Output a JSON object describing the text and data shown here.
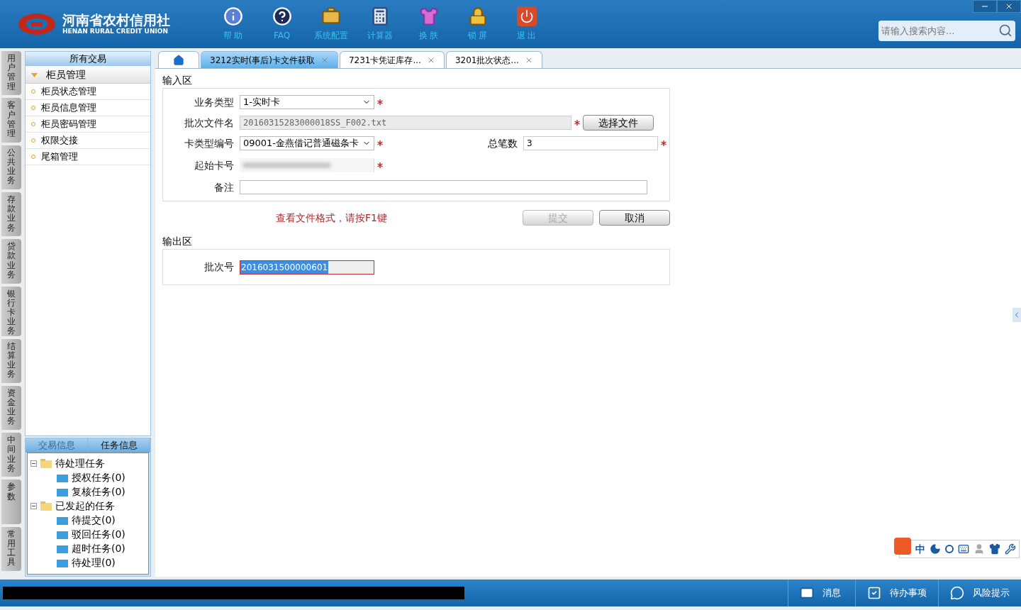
{
  "header": {
    "logo_title": "河南省农村信用社",
    "logo_subtitle": "HENAN RURAL CREDIT UNION",
    "toolbar": [
      {
        "kind": "info",
        "label": "帮 助"
      },
      {
        "kind": "faq",
        "label": "FAQ"
      },
      {
        "kind": "toolbox",
        "label": "系统配置"
      },
      {
        "kind": "calculator",
        "label": "计算器"
      },
      {
        "kind": "shirt",
        "label": "换 肤"
      },
      {
        "kind": "lock",
        "label": "锁 屏"
      },
      {
        "kind": "power",
        "label": "退 出"
      }
    ],
    "search": {
      "placeholder": "请输入搜索内容..."
    }
  },
  "side_tabs": [
    "用户管理",
    "客户管理",
    "公共业务",
    "存款业务",
    "贷款业务",
    "银行卡业务",
    "结算业务",
    "资金业务",
    "中间业务",
    "参数",
    "常用工具"
  ],
  "sidebar": {
    "title": "所有交易",
    "group": {
      "label": "柜员管理",
      "expanded": true,
      "items": [
        "柜员状态管理",
        "柜员信息管理",
        "柜员密码管理",
        "权限交接",
        "尾箱管理"
      ]
    }
  },
  "task_panel": {
    "tabs": [
      {
        "label": "交易信息",
        "selected": false
      },
      {
        "label": "任务信息",
        "selected": true
      }
    ],
    "tree": [
      {
        "label": "待处理任务",
        "expanded": true,
        "children": [
          {
            "label": "授权任务(0)"
          },
          {
            "label": "复核任务(0)"
          }
        ]
      },
      {
        "label": "已发起的任务",
        "expanded": true,
        "children": [
          {
            "label": "待提交(0)"
          },
          {
            "label": "驳回任务(0)"
          },
          {
            "label": "超时任务(0)"
          },
          {
            "label": "待处理(0)"
          }
        ]
      }
    ]
  },
  "tabs": [
    {
      "kind": "home",
      "selected": false
    },
    {
      "kind": "page",
      "label": "3212实时(事后)卡文件获取",
      "selected": true
    },
    {
      "kind": "page",
      "label": "7231卡凭证库存...",
      "selected": false
    },
    {
      "kind": "page",
      "label": "3201批次状态...",
      "selected": false
    }
  ],
  "input_section": {
    "title": "输入区",
    "business_type": {
      "label": "业务类型",
      "value": "1-实时卡",
      "required": true
    },
    "batch_file": {
      "label": "批次文件名",
      "value": "20160315283000018SS_F002.txt",
      "disabled": true,
      "required": true,
      "button": "选择文件"
    },
    "card_type": {
      "label": "卡类型编号",
      "value": "09001-金燕借记普通磁条卡",
      "required": true
    },
    "total_count": {
      "label": "总笔数",
      "value": "3",
      "required": true
    },
    "start_card": {
      "label": "起始卡号",
      "required": true
    },
    "remark": {
      "label": "备注"
    }
  },
  "hint": "查看文件格式，请按F1键",
  "buttons": [
    {
      "label": "提交",
      "disabled": true
    },
    {
      "label": "取消",
      "disabled": false
    }
  ],
  "output_section": {
    "title": "输出区",
    "batch_no": {
      "label": "批次号",
      "value": "2016031500000601",
      "selected": true
    }
  },
  "ime": {
    "mode": "中"
  },
  "status_bar": {
    "items": [
      {
        "kind": "mail",
        "label": "消息"
      },
      {
        "kind": "check",
        "label": "待办事项"
      },
      {
        "kind": "chat",
        "label": "风险提示"
      }
    ]
  }
}
